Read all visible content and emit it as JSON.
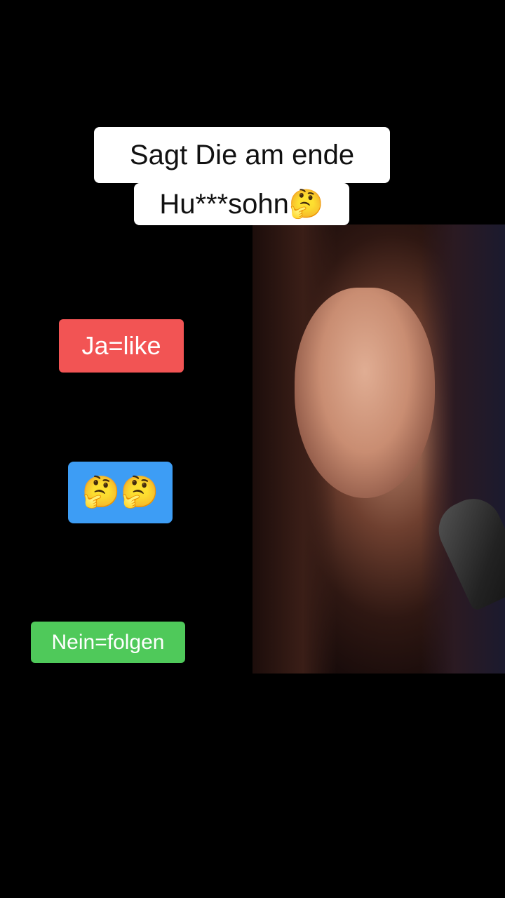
{
  "caption": {
    "line1": "Sagt Die am ende",
    "line2": "Hu***sohn🤔"
  },
  "poll": {
    "yes_label": "Ja=like",
    "middle_emoji": "🤔🤔",
    "no_label": "Nein=folgen"
  },
  "colors": {
    "background": "#000000",
    "caption_bg": "#ffffff",
    "caption_text": "#111111",
    "yes_bg": "#f25454",
    "middle_bg": "#3d9df5",
    "no_bg": "#4fc95a"
  }
}
